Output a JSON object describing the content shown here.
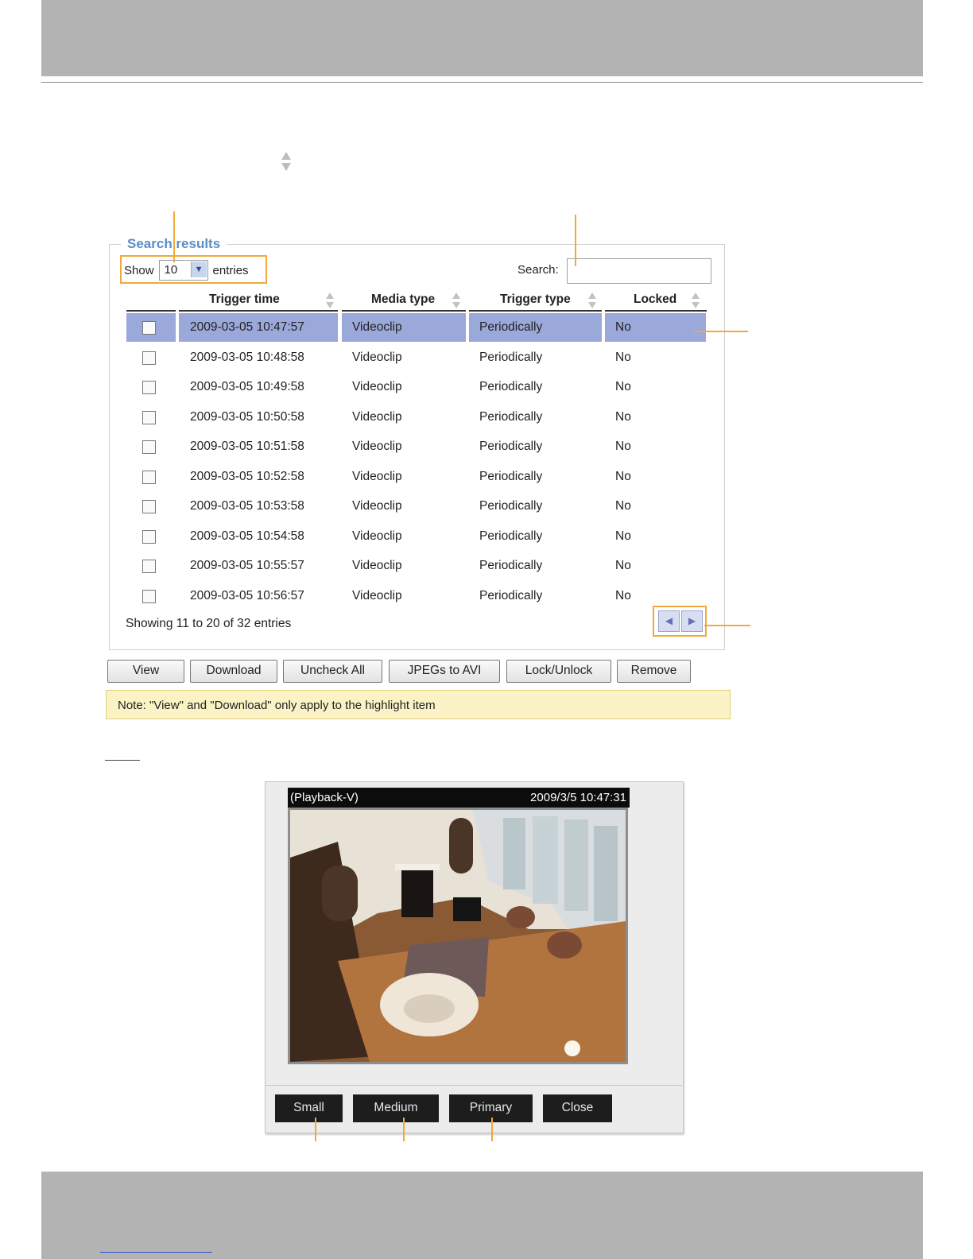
{
  "search": {
    "legend": "Search results",
    "show_label": "Show",
    "page_size": "10",
    "entries_label": "entries",
    "search_label": "Search:",
    "search_value": ""
  },
  "table": {
    "headers": [
      "Trigger time",
      "Media type",
      "Trigger type",
      "Locked"
    ],
    "rows": [
      {
        "time": "2009-03-05 10:47:57",
        "media": "Videoclip",
        "trigger": "Periodically",
        "locked": "No",
        "selected": true
      },
      {
        "time": "2009-03-05 10:48:58",
        "media": "Videoclip",
        "trigger": "Periodically",
        "locked": "No"
      },
      {
        "time": "2009-03-05 10:49:58",
        "media": "Videoclip",
        "trigger": "Periodically",
        "locked": "No"
      },
      {
        "time": "2009-03-05 10:50:58",
        "media": "Videoclip",
        "trigger": "Periodically",
        "locked": "No"
      },
      {
        "time": "2009-03-05 10:51:58",
        "media": "Videoclip",
        "trigger": "Periodically",
        "locked": "No"
      },
      {
        "time": "2009-03-05 10:52:58",
        "media": "Videoclip",
        "trigger": "Periodically",
        "locked": "No"
      },
      {
        "time": "2009-03-05 10:53:58",
        "media": "Videoclip",
        "trigger": "Periodically",
        "locked": "No"
      },
      {
        "time": "2009-03-05 10:54:58",
        "media": "Videoclip",
        "trigger": "Periodically",
        "locked": "No"
      },
      {
        "time": "2009-03-05 10:55:57",
        "media": "Videoclip",
        "trigger": "Periodically",
        "locked": "No"
      },
      {
        "time": "2009-03-05 10:56:57",
        "media": "Videoclip",
        "trigger": "Periodically",
        "locked": "No"
      }
    ],
    "footer": "Showing 11 to 20 of 32 entries"
  },
  "actions": {
    "view": "View",
    "download": "Download",
    "uncheck_all": "Uncheck All",
    "jpegs_to_avi": "JPEGs to AVI",
    "lock_unlock": "Lock/Unlock",
    "remove": "Remove"
  },
  "note": "Note: \"View\" and \"Download\" only apply to the highlight item",
  "playback": {
    "title": "(Playback-V)",
    "timestamp": "2009/3/5 10:47:31",
    "buttons": {
      "small": "Small",
      "medium": "Medium",
      "primary": "Primary",
      "close": "Close"
    }
  },
  "colors": {
    "highlight_row": "#9aa8da",
    "callout": "#f0a93a",
    "legend": "#5b8dc9"
  }
}
